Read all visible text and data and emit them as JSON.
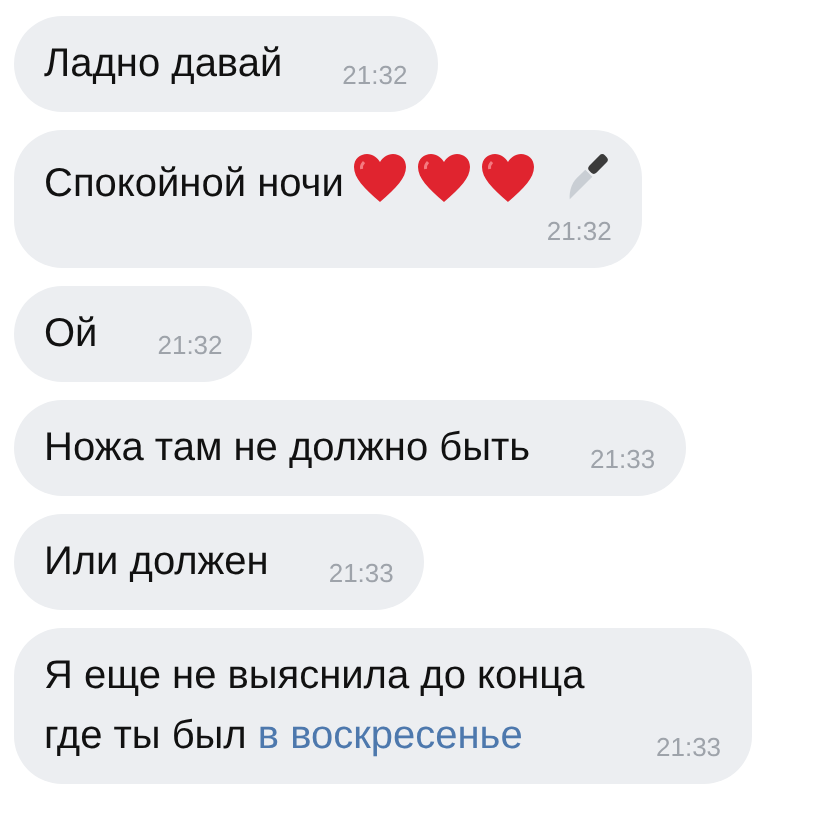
{
  "messages": [
    {
      "kind": "text",
      "text": "Ладно давай",
      "time": "21:32"
    },
    {
      "kind": "emoji",
      "text": "Спокойной ночи",
      "time": "21:32"
    },
    {
      "kind": "text",
      "text": "Ой",
      "time": "21:32"
    },
    {
      "kind": "text",
      "text": "Ножа там не должно быть",
      "time": "21:33"
    },
    {
      "kind": "text",
      "text": "Или должен",
      "time": "21:33"
    },
    {
      "kind": "text",
      "text": "Я еще не выяснила до конца где ты был ",
      "link": "в воскресенье",
      "time": "21:33"
    }
  ]
}
